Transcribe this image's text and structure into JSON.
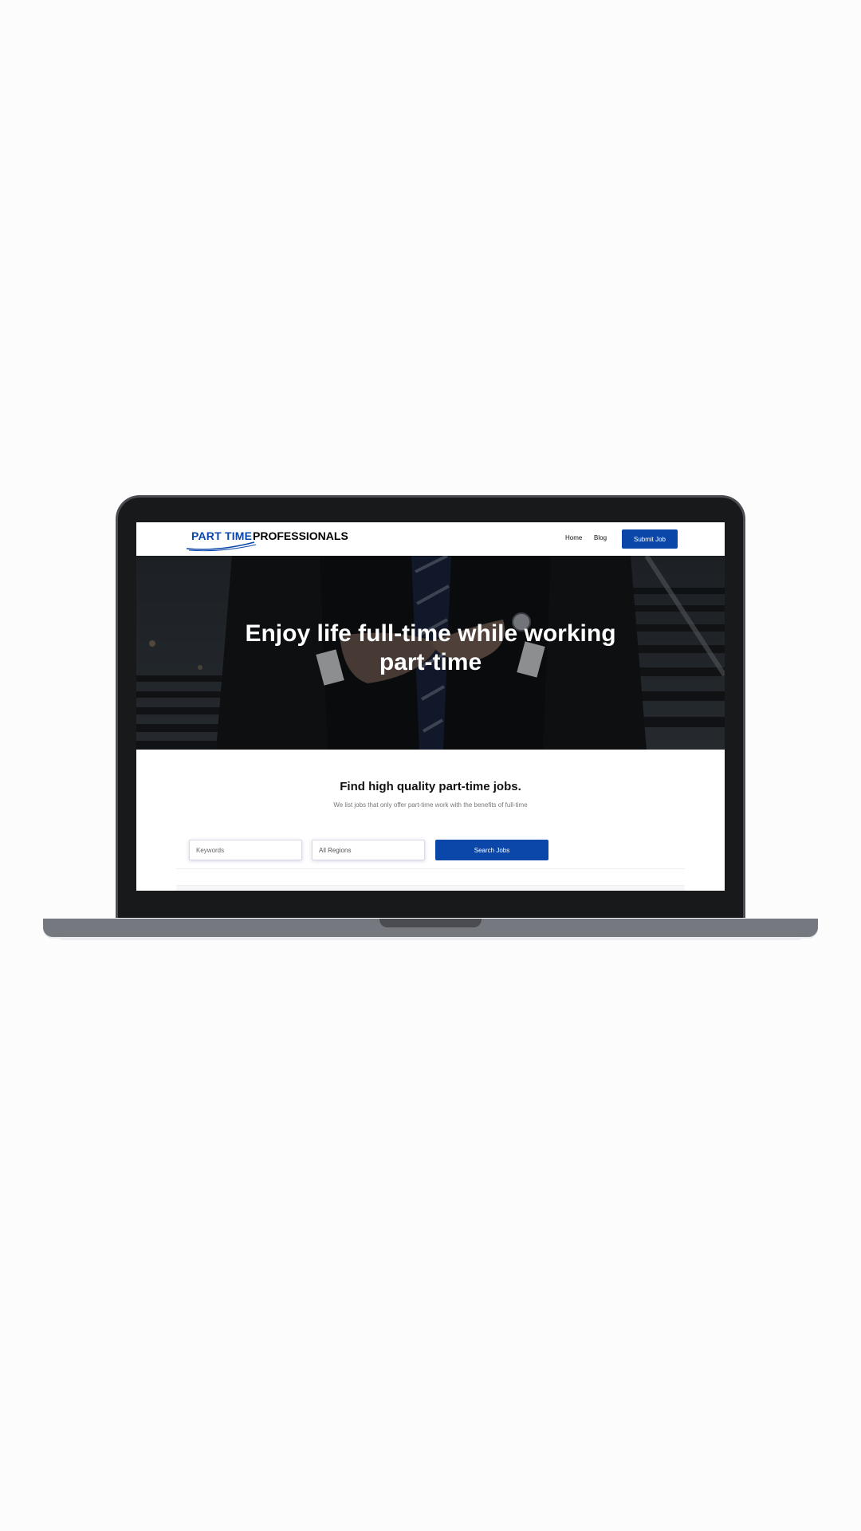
{
  "brand": {
    "name_part1": "PART TIME",
    "name_part2": "PROFESSIONALS",
    "color": "#0a47a9"
  },
  "nav": {
    "home": "Home",
    "blog": "Blog",
    "submit": "Submit Job"
  },
  "hero": {
    "title_line1": "Enjoy life full-time while working",
    "title_line2": "part-time"
  },
  "search": {
    "heading": "Find high quality part-time jobs.",
    "subheading": "We list jobs that only offer part-time work with the benefits of full-time",
    "keywords_placeholder": "Keywords",
    "region_value": "All Regions",
    "button": "Search Jobs"
  },
  "icons": [
    "logo-swoosh-icon"
  ]
}
